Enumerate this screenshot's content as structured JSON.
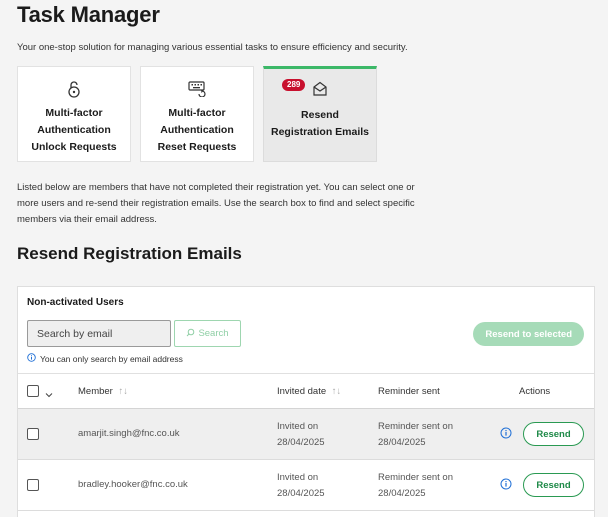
{
  "header": {
    "title": "Task Manager",
    "subtitle": "Your one-stop solution for managing various essential tasks to ensure efficiency and security."
  },
  "cards": [
    {
      "label": "Multi-factor\nAuthentication\nUnlock Requests",
      "icon": "unlock-icon",
      "active": false
    },
    {
      "label": "Multi-factor\nAuthentication\nReset Requests",
      "icon": "keyboard-reset-icon",
      "active": false
    },
    {
      "label": "Resend\nRegistration Emails",
      "icon": "envelope-open-icon",
      "active": true,
      "badge": "289"
    }
  ],
  "intro": "Listed below are members that have not completed their registration yet. You can select one or more users and re-send their registration emails. Use the search box to find and select specific members via their email address.",
  "section_title": "Resend Registration Emails",
  "panel": {
    "heading": "Non-activated Users",
    "search_placeholder": "Search by email",
    "search_button": "Search",
    "resend_selected": "Resend to selected",
    "hint": "You can only search by email address"
  },
  "table": {
    "columns": {
      "member": "Member",
      "invited": "Invited date",
      "reminder": "Reminder sent",
      "actions": "Actions"
    },
    "rows": [
      {
        "email": "amarjit.singh@fnc.co.uk",
        "invited_label": "Invited on",
        "invited_date": "28/04/2025",
        "reminder_label": "Reminder sent on",
        "reminder_date": "28/04/2025",
        "action": "Resend"
      },
      {
        "email": "bradley.hooker@fnc.co.uk",
        "invited_label": "Invited on",
        "invited_date": "28/04/2025",
        "reminder_label": "Reminder sent on",
        "reminder_date": "28/04/2025",
        "action": "Resend"
      }
    ]
  },
  "colors": {
    "accent_green": "#3cb868",
    "badge_red": "#c8102e",
    "info_blue": "#1f6fd6"
  }
}
